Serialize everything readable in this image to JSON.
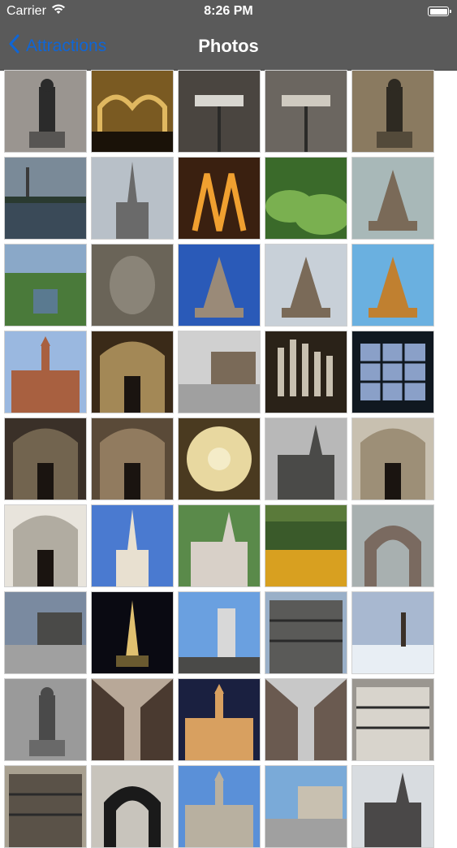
{
  "status_bar": {
    "carrier": "Carrier",
    "time": "8:26 PM"
  },
  "nav": {
    "back_label": "Attractions",
    "title": "Photos"
  },
  "photos": [
    {
      "name": "statue-group",
      "bg": "#9a9590",
      "accent": "#2b2b2b",
      "type": "statue"
    },
    {
      "name": "gold-arcade",
      "bg": "#7a5a22",
      "accent": "#e0b860",
      "type": "arcade"
    },
    {
      "name": "street-sign",
      "bg": "#4a4540",
      "accent": "#d8d6d0",
      "type": "sign"
    },
    {
      "name": "corner-sign",
      "bg": "#6b6660",
      "accent": "#cfcac0",
      "type": "sign"
    },
    {
      "name": "bronze-figures",
      "bg": "#8a7a60",
      "accent": "#2e2a22",
      "type": "statue"
    },
    {
      "name": "lake-tower",
      "bg": "#7a8a98",
      "accent": "#2a3a30",
      "type": "lake"
    },
    {
      "name": "church-spire",
      "bg": "#b8c0c8",
      "accent": "#6a6a6a",
      "type": "spire"
    },
    {
      "name": "lit-arches",
      "bg": "#3a2010",
      "accent": "#f0a030",
      "type": "arches"
    },
    {
      "name": "garden-plants",
      "bg": "#3a6a2a",
      "accent": "#7ab050",
      "type": "plants"
    },
    {
      "name": "monument-tree",
      "bg": "#a8b8b8",
      "accent": "#7a6a58",
      "type": "monument"
    },
    {
      "name": "aerial-park",
      "bg": "#8aa8c8",
      "accent": "#4a7a3a",
      "type": "aerial"
    },
    {
      "name": "stone-carving",
      "bg": "#6a6458",
      "accent": "#8a8478",
      "type": "carving"
    },
    {
      "name": "monument-blue",
      "bg": "#2a5ab8",
      "accent": "#9a8a78",
      "type": "monument"
    },
    {
      "name": "monument-reflect",
      "bg": "#c8d0d8",
      "accent": "#7a6a58",
      "type": "monument"
    },
    {
      "name": "monument-gold",
      "bg": "#6ab0e0",
      "accent": "#c08030",
      "type": "monument"
    },
    {
      "name": "old-town-hall",
      "bg": "#9ab8e0",
      "accent": "#a86040",
      "type": "hall"
    },
    {
      "name": "concert-hall",
      "bg": "#3a2a18",
      "accent": "#d0b070",
      "type": "interior"
    },
    {
      "name": "square-building",
      "bg": "#d0d0d0",
      "accent": "#7a6a58",
      "type": "square"
    },
    {
      "name": "organ-pipes",
      "bg": "#2a2218",
      "accent": "#c8c0b0",
      "type": "organ"
    },
    {
      "name": "stained-window",
      "bg": "#101820",
      "accent": "#8aa0c8",
      "type": "window"
    },
    {
      "name": "church-nave",
      "bg": "#3a3028",
      "accent": "#8a7a60",
      "type": "interior"
    },
    {
      "name": "columns-hall",
      "bg": "#5a4a38",
      "accent": "#a89070",
      "type": "interior"
    },
    {
      "name": "dome-ceiling",
      "bg": "#4a3a20",
      "accent": "#e8d8a0",
      "type": "dome"
    },
    {
      "name": "gothic-church",
      "bg": "#b8b8b8",
      "accent": "#4a4a48",
      "type": "church"
    },
    {
      "name": "baroque-interior",
      "bg": "#c8c0b0",
      "accent": "#8a7a60",
      "type": "interior"
    },
    {
      "name": "white-hall",
      "bg": "#e8e4dc",
      "accent": "#9a9488",
      "type": "interior"
    },
    {
      "name": "russian-church",
      "bg": "#4a7ad0",
      "accent": "#e8e0d0",
      "type": "spire"
    },
    {
      "name": "memorial-green",
      "bg": "#5a8a4a",
      "accent": "#d8d0c8",
      "type": "church"
    },
    {
      "name": "meadow-forest",
      "bg": "#5a7a3a",
      "accent": "#d8a020",
      "type": "meadow"
    },
    {
      "name": "zoo-gate",
      "bg": "#a8b0b0",
      "accent": "#7a6a60",
      "type": "gate"
    },
    {
      "name": "plaza-dusk",
      "bg": "#7a8aa0",
      "accent": "#4a4a48",
      "type": "square"
    },
    {
      "name": "night-obelisk",
      "bg": "#0a0a12",
      "accent": "#e0c070",
      "type": "obelisk"
    },
    {
      "name": "highrise-street",
      "bg": "#6aa0e0",
      "accent": "#d8d8d8",
      "type": "tower"
    },
    {
      "name": "modern-building",
      "bg": "#9ab0c8",
      "accent": "#5a5a58",
      "type": "facade"
    },
    {
      "name": "snowy-park",
      "bg": "#a8b8d0",
      "accent": "#e8eef4",
      "type": "snow"
    },
    {
      "name": "fountain-column",
      "bg": "#9a9a9a",
      "accent": "#4a4a4a",
      "type": "statue"
    },
    {
      "name": "narrow-street",
      "bg": "#b8a898",
      "accent": "#4a3a30",
      "type": "street"
    },
    {
      "name": "town-hall-night",
      "bg": "#1a2040",
      "accent": "#d8a060",
      "type": "hall"
    },
    {
      "name": "shopping-street",
      "bg": "#c8c8c8",
      "accent": "#6a5a50",
      "type": "street"
    },
    {
      "name": "ornate-facade",
      "bg": "#9a9690",
      "accent": "#d8d4cc",
      "type": "facade"
    },
    {
      "name": "gothic-detail",
      "bg": "#a8a090",
      "accent": "#5a5248",
      "type": "facade"
    },
    {
      "name": "iron-gate",
      "bg": "#c8c4bc",
      "accent": "#1a1a1a",
      "type": "gate"
    },
    {
      "name": "domed-building",
      "bg": "#5a90d8",
      "accent": "#b8b0a0",
      "type": "hall"
    },
    {
      "name": "city-skyline",
      "bg": "#7aaad8",
      "accent": "#c8c0b0",
      "type": "square"
    },
    {
      "name": "cathedral-towers",
      "bg": "#d8dce0",
      "accent": "#4a4848",
      "type": "church"
    }
  ]
}
